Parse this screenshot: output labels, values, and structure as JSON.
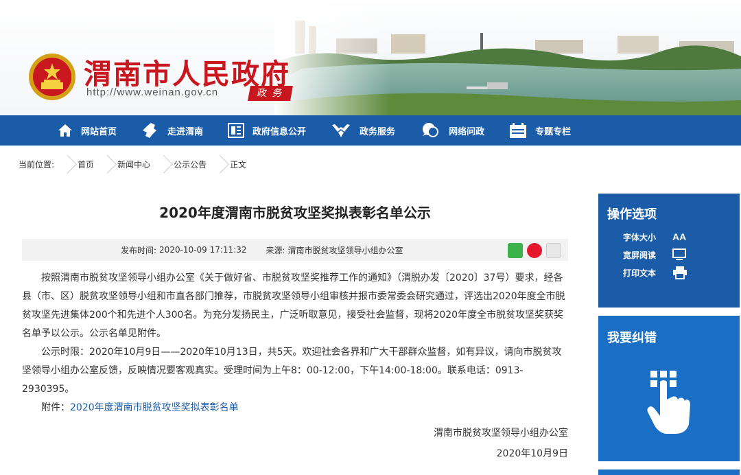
{
  "header": {
    "title": "渭南市人民政府",
    "url": "http://www.weinan.gov.cn",
    "tag": "政 务"
  },
  "nav": {
    "items": [
      {
        "label": "网站首页",
        "icon": "home-icon"
      },
      {
        "label": "走进渭南",
        "icon": "map-icon"
      },
      {
        "label": "政府信息公开",
        "icon": "document-icon"
      },
      {
        "label": "政务服务",
        "icon": "hands-icon"
      },
      {
        "label": "网络问政",
        "icon": "chat-icon"
      },
      {
        "label": "专题专栏",
        "icon": "calendar-icon"
      }
    ]
  },
  "breadcrumb": {
    "prefix": "当前位置:",
    "items": [
      "首页",
      "新闻中心",
      "公示公告",
      "正文"
    ]
  },
  "article": {
    "title": "2020年度渭南市脱贫攻坚奖拟表彰名单公示",
    "publish_label": "发布时间:",
    "publish_time": "2020-10-09 17:11:32",
    "source_label": "来源:",
    "source": "渭南市脱贫攻坚领导小组办公室",
    "paragraphs": [
      "按照渭南市脱贫攻坚领导小组办公室《关于做好省、市脱贫攻坚奖推荐工作的通知》（渭脱办发〔2020〕37号）要求，经各县（市、区）脱贫攻坚领导小组和市直各部门推荐，市脱贫攻坚领导小组审核并报市委常委会研究通过，评选出2020年度全市脱贫攻坚先进集体200个和先进个人300名。为充分发扬民主，广泛听取意见，接受社会监督，现将2020年度全市脱贫攻坚奖获奖名单予以公示。公示名单见附件。",
      "公示时限：2020年10月9日——2020年10月13日，共5天。欢迎社会各界和广大干部群众监督，如有异议，请向市脱贫攻坚领导小组办公室反馈，反映情况要客观真实。受理时间为上午8：00-12:00，下午14:00-18:00。联系电话：0913-2930395。"
    ],
    "attachment_label": "附件：",
    "attachment_link": "2020年度渭南市脱贫攻坚奖拟表彰名单",
    "signature": "渭南市脱贫攻坚领导小组办公室",
    "date": "2020年10月9日"
  },
  "sidebar": {
    "options_title": "操作选项",
    "options": [
      {
        "label": "字体大小",
        "icon_text": "AA"
      },
      {
        "label": "宽屏阅读",
        "icon": "monitor-icon"
      },
      {
        "label": "打印文本",
        "icon": "printer-icon"
      }
    ],
    "correction_title": "我要纠错"
  },
  "colors": {
    "brand_red": "#c8171e",
    "nav_blue": "#1a5ca8",
    "side_blue": "#1a6fc4"
  }
}
